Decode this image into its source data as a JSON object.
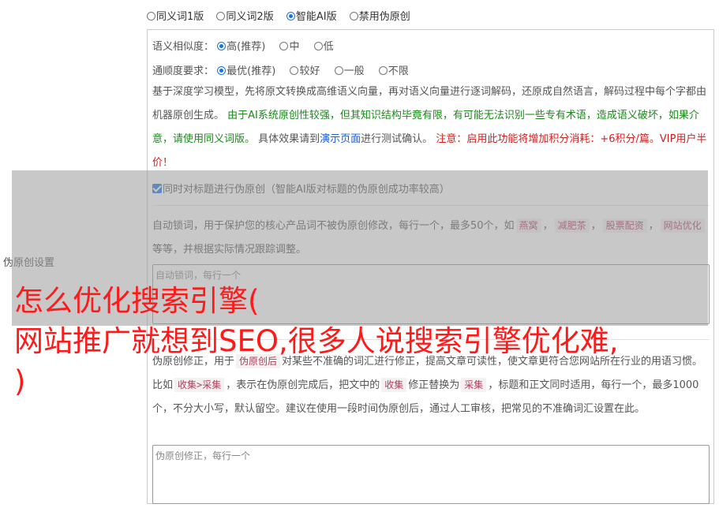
{
  "version_options": [
    {
      "label": "同义词1版",
      "checked": false
    },
    {
      "label": "同义词2版",
      "checked": false
    },
    {
      "label": "智能AI版",
      "checked": true
    },
    {
      "label": "禁用伪原创",
      "checked": false
    }
  ],
  "similarity": {
    "label": "语义相似度：",
    "options": [
      {
        "label": "高(推荐)",
        "checked": true
      },
      {
        "label": "中",
        "checked": false
      },
      {
        "label": "低",
        "checked": false
      }
    ]
  },
  "fluency": {
    "label": "通顺度要求：",
    "options": [
      {
        "label": "最优(推荐)",
        "checked": true
      },
      {
        "label": "较好",
        "checked": false
      },
      {
        "label": "一般",
        "checked": false
      },
      {
        "label": "不限",
        "checked": false
      }
    ]
  },
  "description": {
    "part1": "基于深度学习模型，先将原文转换成高维语义向量，再对语义向量进行逐词解码，还原成自然语言，解码过程中每个字都由机器原创生成。 ",
    "part2_green": "由于AI系统原创性较强，但其知识结构毕竟有限，有可能无法识别一些专有术语，造成语义破坏，如果介意，请使用同义词版。",
    "part3": " 具体效果请到",
    "demo_link": "演示页面",
    "part4": "进行测试确认。 ",
    "part5_red": "注意：启用此功能将增加积分消耗：+6积分/篇。VIP用户半价！"
  },
  "title_checkbox": {
    "label": "同时对标题进行伪原创（智能AI版对标题的伪原创成功率较高）",
    "checked": true
  },
  "lock_words": {
    "text_before": "自动锁词，用于保护您的核心产品词不被伪原创修改，每行一个，最多50个，如",
    "tags": [
      "燕窝",
      "减肥茶",
      "股票配资",
      "网站优化"
    ],
    "text_after": "等等，并根据实际情况跟踪调整。",
    "placeholder": "自动锁词，每行一个"
  },
  "correction": {
    "line1_prefix": "伪原创修正，用于",
    "tag1": "伪原创后",
    "line1_suffix": "对某些不准确的词汇进行修正，提高文章可读性，使文章更符合您网站所在行业的用语习惯。比如",
    "tag2": "收集>采集",
    "mid": "，表示在伪原创完成后，把文中的",
    "tag3": "收集",
    "mid2": "修正替换为",
    "tag4": "采集",
    "tail": "，标题和正文同时适用，每行一个，最多1000个，不分大小写，默认留空。建议在使用一段时间伪原创后，通过人工审核，把常见的不准确词汇设置在此。",
    "placeholder": "伪原创修正，每行一个"
  },
  "side_label": "伪原创设置",
  "headline": "怎么优化搜索引擎(\n网站推广就想到SEO,很多人说搜索引擎优化难,\n)",
  "colors": {
    "accent": "#1a73e8",
    "headline": "#ff1a1a",
    "green": "#1a8a1a",
    "red": "#d21f1f",
    "link": "#1a5bd8"
  }
}
